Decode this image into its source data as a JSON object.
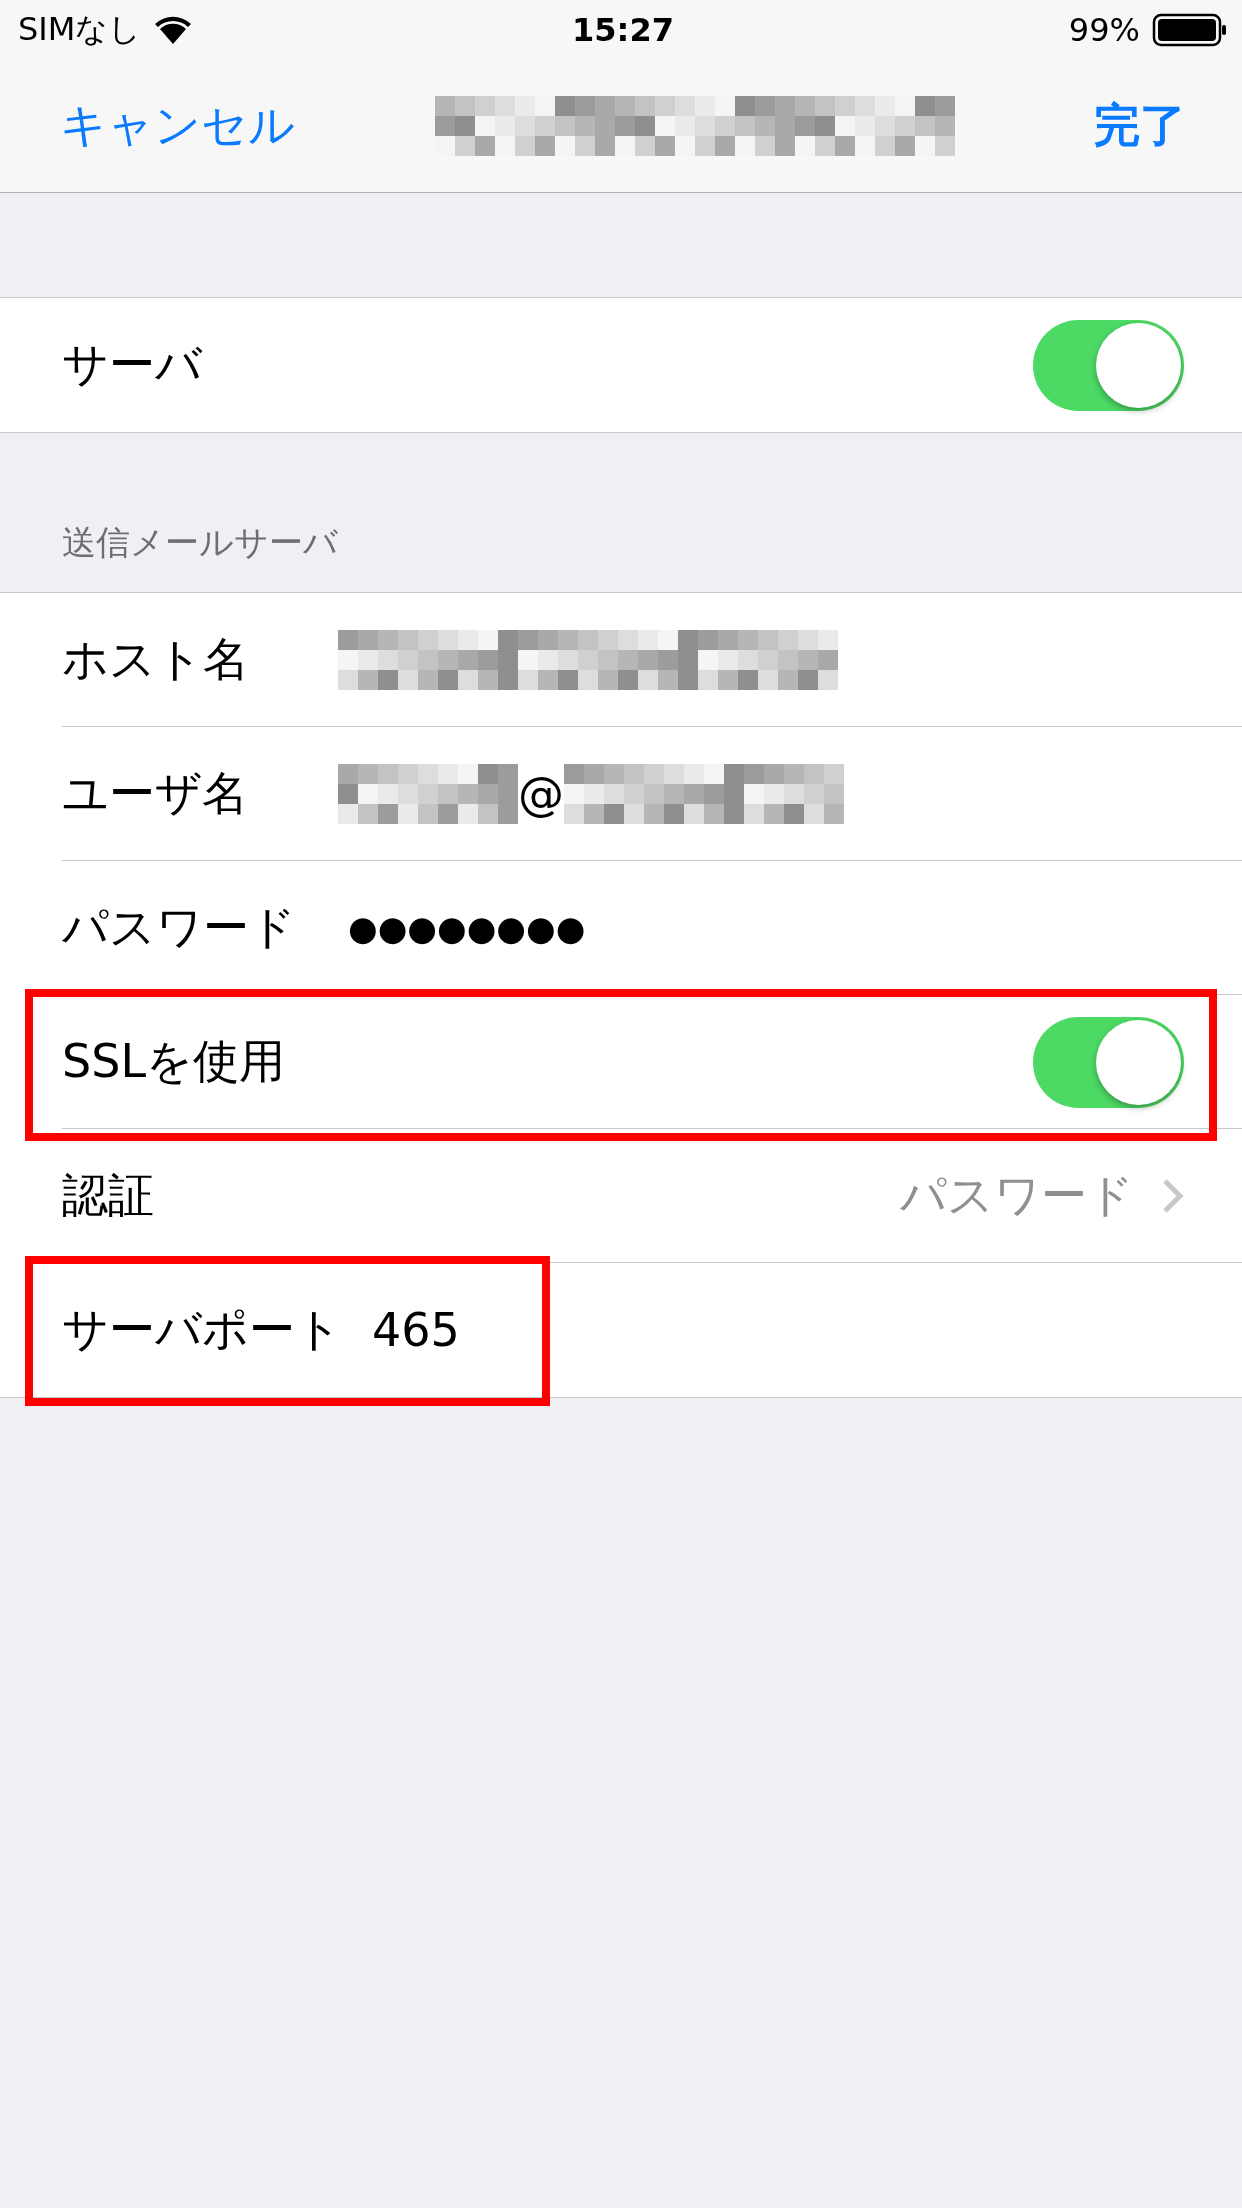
{
  "status_bar": {
    "carrier": "SIMなし",
    "time": "15:27",
    "battery": "99%"
  },
  "nav_bar": {
    "cancel": "キャンセル",
    "title": {
      "kind": "redacted"
    },
    "done": "完了"
  },
  "server_section": {
    "rows": [
      {
        "kind": "toggle",
        "label": "サーバ",
        "on": true,
        "highlighted": false
      }
    ]
  },
  "outgoing_section": {
    "header": "送信メールサーバ",
    "rows": [
      {
        "kind": "redacted",
        "label": "ホスト名",
        "highlighted": false
      },
      {
        "kind": "redacted_email",
        "label": "ユーザ名",
        "value": "@",
        "highlighted": false
      },
      {
        "kind": "text",
        "label": "パスワード",
        "value": "●●●●●●●●",
        "highlighted": false
      },
      {
        "kind": "toggle",
        "label": "SSLを使用",
        "on": true,
        "highlighted": true
      },
      {
        "kind": "disclosure",
        "label": "認証",
        "value": "パスワード",
        "highlighted": false
      },
      {
        "kind": "inline",
        "label": "サーバポート",
        "value": "465",
        "highlighted": true
      }
    ]
  }
}
